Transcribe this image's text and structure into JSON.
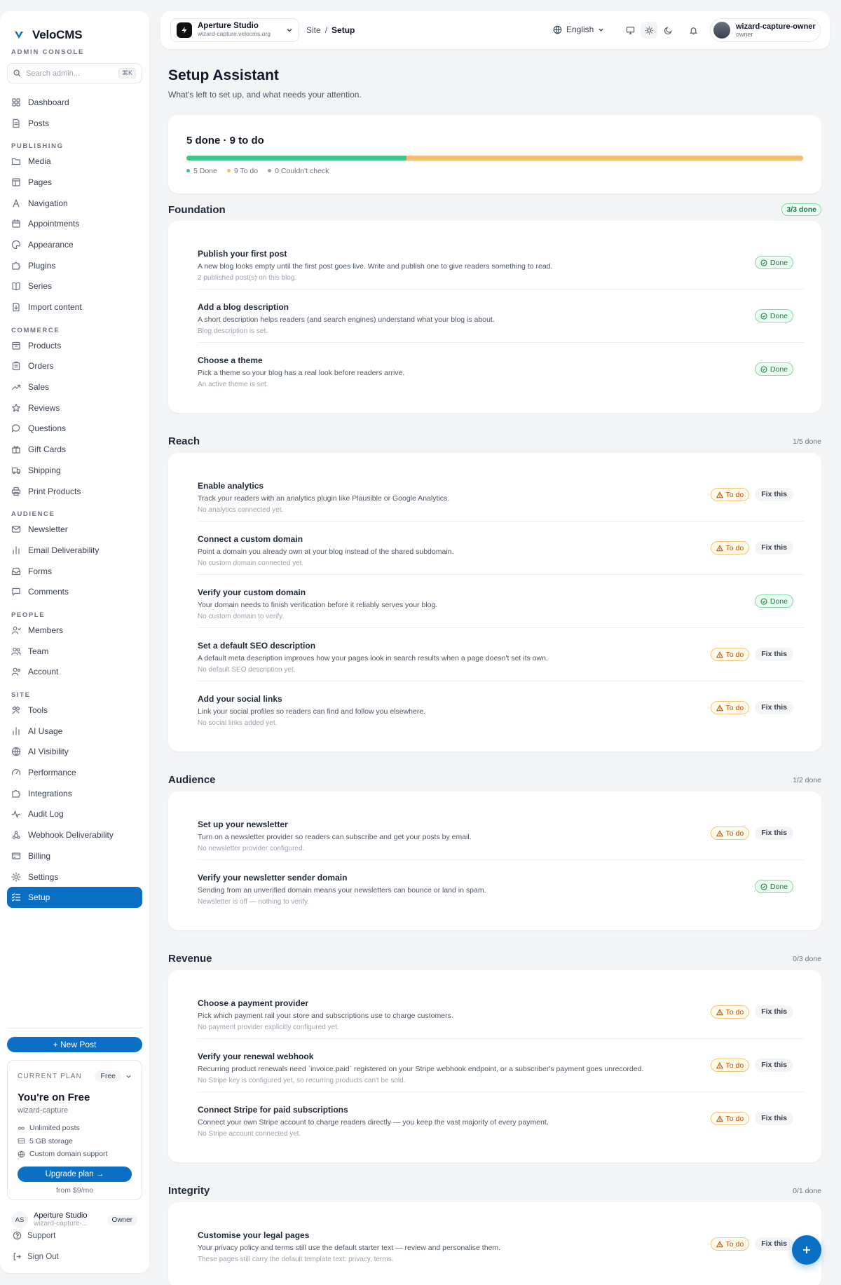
{
  "app": {
    "name": "VeloCMS",
    "console_label": "ADMIN CONSOLE"
  },
  "search": {
    "placeholder": "Search admin...",
    "shortcut": "⌘K"
  },
  "nav": [
    {
      "type": "item",
      "label": "Dashboard",
      "icon": "dashboard-icon"
    },
    {
      "type": "item",
      "label": "Posts",
      "icon": "posts-icon"
    },
    {
      "type": "head",
      "label": "PUBLISHING"
    },
    {
      "type": "item",
      "label": "Media",
      "icon": "folder-icon"
    },
    {
      "type": "item",
      "label": "Pages",
      "icon": "pages-icon"
    },
    {
      "type": "item",
      "label": "Navigation",
      "icon": "navigation-icon"
    },
    {
      "type": "item",
      "label": "Appointments",
      "icon": "calendar-icon"
    },
    {
      "type": "item",
      "label": "Appearance",
      "icon": "palette-icon"
    },
    {
      "type": "item",
      "label": "Plugins",
      "icon": "puzzle-icon"
    },
    {
      "type": "item",
      "label": "Series",
      "icon": "book-icon"
    },
    {
      "type": "item",
      "label": "Import content",
      "icon": "import-icon"
    },
    {
      "type": "head",
      "label": "COMMERCE"
    },
    {
      "type": "item",
      "label": "Products",
      "icon": "box-icon"
    },
    {
      "type": "item",
      "label": "Orders",
      "icon": "clipboard-icon"
    },
    {
      "type": "item",
      "label": "Sales",
      "icon": "trending-icon"
    },
    {
      "type": "item",
      "label": "Reviews",
      "icon": "star-icon"
    },
    {
      "type": "item",
      "label": "Questions",
      "icon": "chat-icon"
    },
    {
      "type": "item",
      "label": "Gift Cards",
      "icon": "gift-icon"
    },
    {
      "type": "item",
      "label": "Shipping",
      "icon": "truck-icon"
    },
    {
      "type": "item",
      "label": "Print Products",
      "icon": "printer-icon"
    },
    {
      "type": "head",
      "label": "AUDIENCE"
    },
    {
      "type": "item",
      "label": "Newsletter",
      "icon": "mail-icon"
    },
    {
      "type": "item",
      "label": "Email Deliverability",
      "icon": "bar-chart-icon"
    },
    {
      "type": "item",
      "label": "Forms",
      "icon": "inbox-icon"
    },
    {
      "type": "item",
      "label": "Comments",
      "icon": "comment-icon"
    },
    {
      "type": "head",
      "label": "PEOPLE"
    },
    {
      "type": "item",
      "label": "Members",
      "icon": "member-icon"
    },
    {
      "type": "item",
      "label": "Team",
      "icon": "team-icon"
    },
    {
      "type": "item",
      "label": "Account",
      "icon": "account-icon"
    },
    {
      "type": "head",
      "label": "SITE"
    },
    {
      "type": "item",
      "label": "Tools",
      "icon": "tools-icon"
    },
    {
      "type": "item",
      "label": "AI Usage",
      "icon": "bar-chart-icon"
    },
    {
      "type": "item",
      "label": "AI Visibility",
      "icon": "globe-icon"
    },
    {
      "type": "item",
      "label": "Performance",
      "icon": "gauge-icon"
    },
    {
      "type": "item",
      "label": "Integrations",
      "icon": "puzzle-icon"
    },
    {
      "type": "item",
      "label": "Audit Log",
      "icon": "activity-icon"
    },
    {
      "type": "item",
      "label": "Webhook Deliverability",
      "icon": "webhook-icon"
    },
    {
      "type": "item",
      "label": "Billing",
      "icon": "card-icon"
    },
    {
      "type": "item",
      "label": "Settings",
      "icon": "gear-icon"
    },
    {
      "type": "item",
      "label": "Setup",
      "icon": "checklist-icon",
      "active": true
    }
  ],
  "new_post_label": "+ New Post",
  "plan": {
    "label": "CURRENT PLAN",
    "badge": "Free",
    "title": "You're on Free",
    "site": "wizard-capture",
    "features": [
      {
        "icon": "infinity-icon",
        "text": "Unlimited posts"
      },
      {
        "icon": "storage-icon",
        "text": "5 GB storage"
      },
      {
        "icon": "globe-icon",
        "text": "Custom domain support"
      }
    ],
    "upgrade_label": "Upgrade plan →",
    "price_note": "from $9/mo"
  },
  "org": {
    "initials": "AS",
    "name": "Aperture Studio",
    "sub": "wizard-capture-...",
    "role": "Owner"
  },
  "support_label": "Support",
  "signout_label": "Sign Out",
  "topbar": {
    "workspace_name": "Aperture Studio",
    "workspace_url": "wizard-capture.velocms.org",
    "crumb_root": "Site",
    "crumb_sep": "/",
    "crumb_current": "Setup",
    "language": "English",
    "user_name": "wizard-capture-owner",
    "user_role": "owner"
  },
  "page": {
    "title": "Setup Assistant",
    "subtitle": "What's left to set up, and what needs your attention."
  },
  "summary": {
    "title": "5 done · 9 to do",
    "done_fraction": 0.357,
    "legend": [
      {
        "label": "5 Done",
        "color": "#42c48a"
      },
      {
        "label": "9 To do",
        "color": "#f0bd73"
      },
      {
        "label": "0 Couldn't check",
        "color": "#9ca3af"
      }
    ]
  },
  "sections": [
    {
      "title": "Foundation",
      "count": "3/3 done",
      "complete": true,
      "tasks": [
        {
          "title": "Publish your first post",
          "desc": "A new blog looks empty until the first post goes live. Write and publish one to give readers something to read.",
          "note": "2 published post(s) on this blog.",
          "status": "Done"
        },
        {
          "title": "Add a blog description",
          "desc": "A short description helps readers (and search engines) understand what your blog is about.",
          "note": "Blog description is set.",
          "status": "Done"
        },
        {
          "title": "Choose a theme",
          "desc": "Pick a theme so your blog has a real look before readers arrive.",
          "note": "An active theme is set.",
          "status": "Done"
        }
      ]
    },
    {
      "title": "Reach",
      "count": "1/5 done",
      "complete": false,
      "tasks": [
        {
          "title": "Enable analytics",
          "desc": "Track your readers with an analytics plugin like Plausible or Google Analytics.",
          "note": "No analytics connected yet.",
          "status": "To do",
          "action": "Fix this"
        },
        {
          "title": "Connect a custom domain",
          "desc": "Point a domain you already own at your blog instead of the shared subdomain.",
          "note": "No custom domain connected yet.",
          "status": "To do",
          "action": "Fix this"
        },
        {
          "title": "Verify your custom domain",
          "desc": "Your domain needs to finish verification before it reliably serves your blog.",
          "note": "No custom domain to verify.",
          "status": "Done"
        },
        {
          "title": "Set a default SEO description",
          "desc": "A default meta description improves how your pages look in search results when a page doesn't set its own.",
          "note": "No default SEO description yet.",
          "status": "To do",
          "action": "Fix this"
        },
        {
          "title": "Add your social links",
          "desc": "Link your social profiles so readers can find and follow you elsewhere.",
          "note": "No social links added yet.",
          "status": "To do",
          "action": "Fix this"
        }
      ]
    },
    {
      "title": "Audience",
      "count": "1/2 done",
      "complete": false,
      "tasks": [
        {
          "title": "Set up your newsletter",
          "desc": "Turn on a newsletter provider so readers can subscribe and get your posts by email.",
          "note": "No newsletter provider configured.",
          "status": "To do",
          "action": "Fix this"
        },
        {
          "title": "Verify your newsletter sender domain",
          "desc": "Sending from an unverified domain means your newsletters can bounce or land in spam.",
          "note": "Newsletter is off — nothing to verify.",
          "status": "Done"
        }
      ]
    },
    {
      "title": "Revenue",
      "count": "0/3 done",
      "complete": false,
      "tasks": [
        {
          "title": "Choose a payment provider",
          "desc": "Pick which payment rail your store and subscriptions use to charge customers.",
          "note": "No payment provider explicitly configured yet.",
          "status": "To do",
          "action": "Fix this"
        },
        {
          "title": "Verify your renewal webhook",
          "desc": "Recurring product renewals need `invoice.paid` registered on your Stripe webhook endpoint, or a subscriber's payment goes unrecorded.",
          "note": "No Stripe key is configured yet, so recurring products can't be sold.",
          "status": "To do",
          "action": "Fix this"
        },
        {
          "title": "Connect Stripe for paid subscriptions",
          "desc": "Connect your own Stripe account to charge readers directly — you keep the vast majority of every payment.",
          "note": "No Stripe account connected yet.",
          "status": "To do",
          "action": "Fix this"
        }
      ]
    },
    {
      "title": "Integrity",
      "count": "0/1 done",
      "complete": false,
      "tasks": [
        {
          "title": "Customise your legal pages",
          "desc": "Your privacy policy and terms still use the default starter text — review and personalise them.",
          "note": "These pages still carry the default template text: privacy, terms.",
          "status": "To do",
          "action": "Fix this"
        }
      ]
    }
  ],
  "colors": {
    "accent": "#0b6fc4",
    "done": "#42c48a",
    "todo": "#f0bd73"
  }
}
